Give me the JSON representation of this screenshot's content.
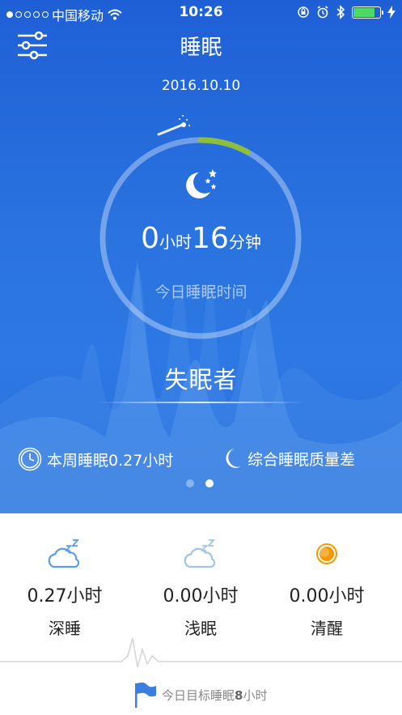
{
  "status_bar": {
    "carrier": "中国移动",
    "time": "10:26",
    "battery_color": "#4cd964"
  },
  "header": {
    "title": "睡眠",
    "menu_icon": "filter-sliders-icon"
  },
  "date": "2016.10.10",
  "summary": {
    "hours": "0",
    "hours_unit": "小时",
    "minutes": "16",
    "minutes_unit": "分钟",
    "label": "今日睡眠时间",
    "progress_fraction": 0.08
  },
  "sleeper_type": "失眠者",
  "info": {
    "week_sleep": "本周睡眠0.27小时",
    "quality": "综合睡眠质量差"
  },
  "pager": {
    "pages": 2,
    "active": 1
  },
  "stats": [
    {
      "value": "0.27小时",
      "name": "深睡",
      "icon": "cloud-zzz-icon"
    },
    {
      "value": "0.00小时",
      "name": "浅眠",
      "icon": "cloud-zzz-light-icon"
    },
    {
      "value": "0.00小时",
      "name": "清醒",
      "icon": "awake-circle-icon"
    }
  ],
  "target": {
    "prefix": "今日目标睡眠",
    "value": "8",
    "suffix": "小时"
  },
  "colors": {
    "primary_blue": "#2a73e0",
    "awake_orange": "#f39800",
    "ring_accent": "#8fbf3a"
  }
}
